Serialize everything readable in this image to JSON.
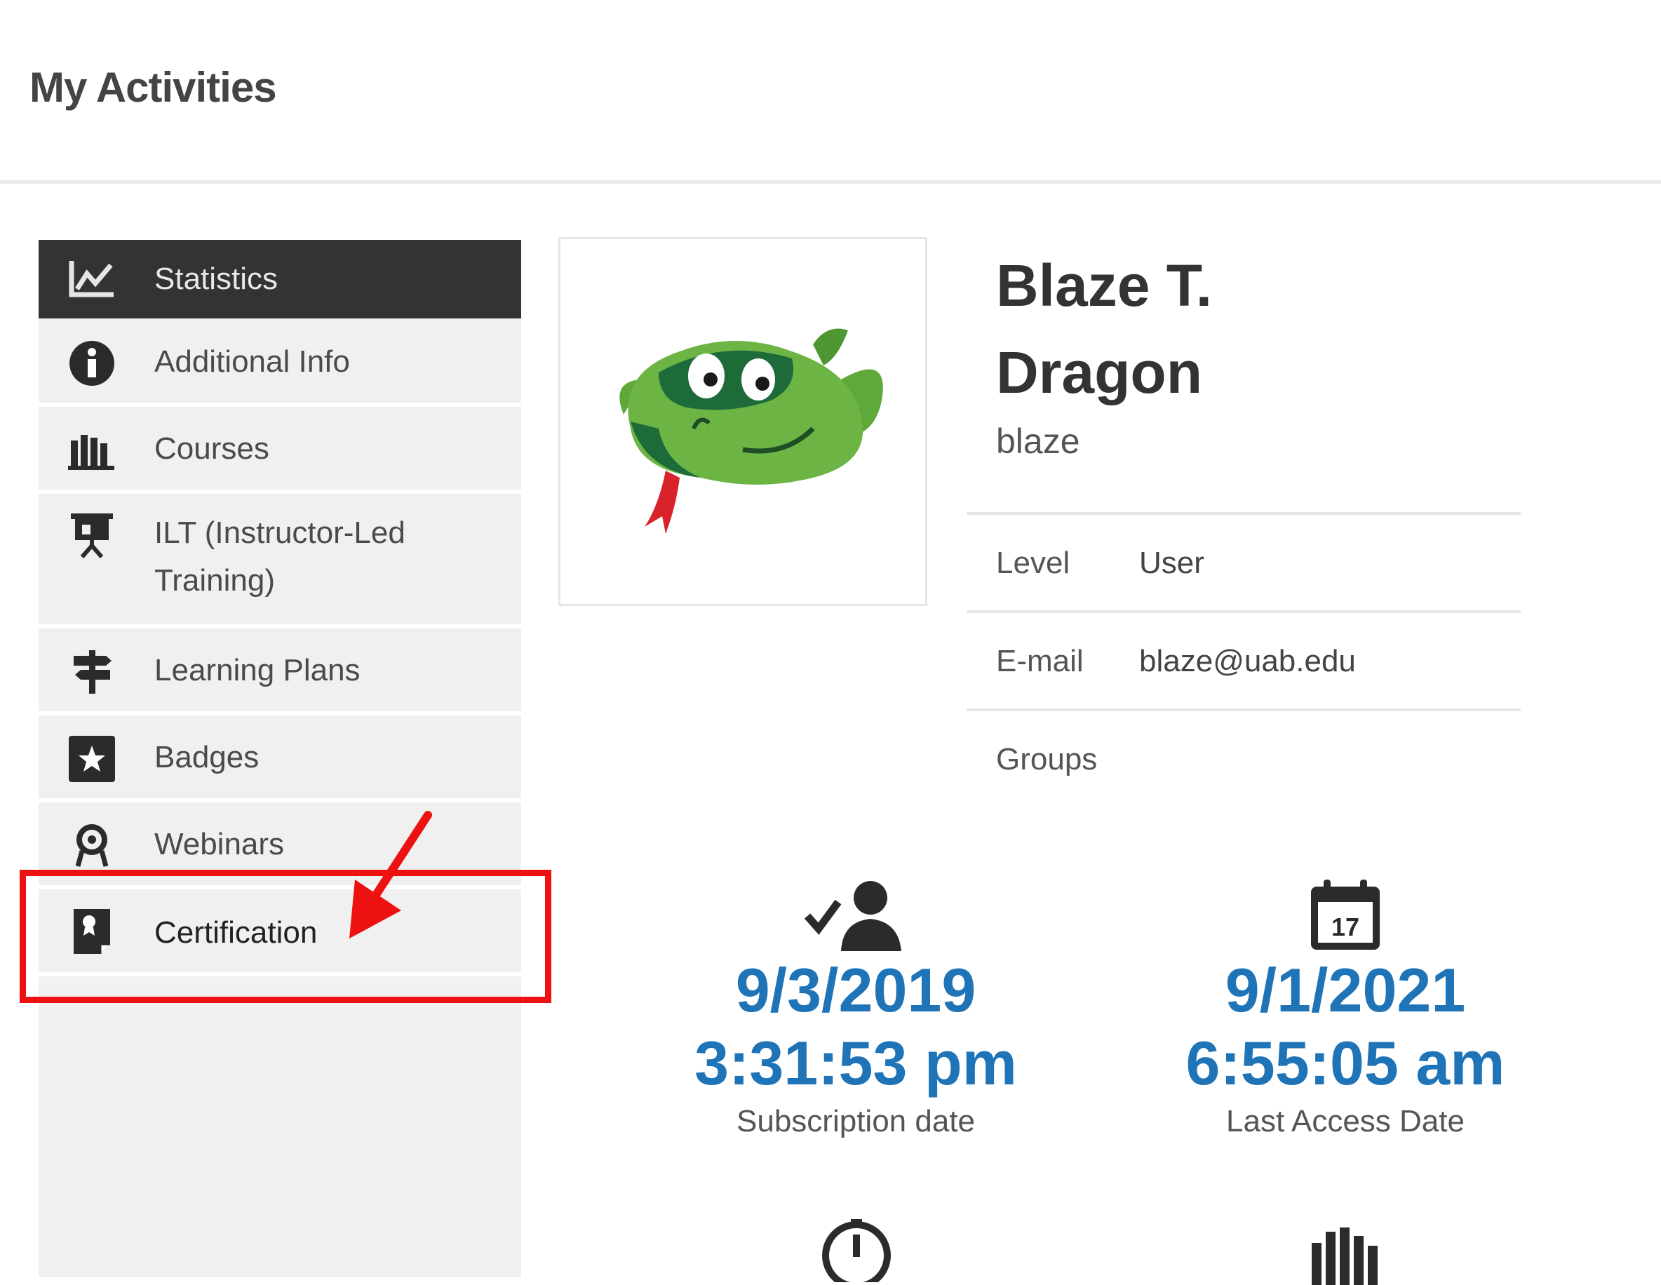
{
  "page": {
    "title": "My Activities"
  },
  "sidebar": {
    "items": [
      {
        "label": "Statistics",
        "icon": "chart-icon",
        "active": true
      },
      {
        "label": "Additional Info",
        "icon": "info-icon"
      },
      {
        "label": "Courses",
        "icon": "courses-icon"
      },
      {
        "label": "ILT (Instructor-Led\nTraining)",
        "icon": "presentation-icon"
      },
      {
        "label": "Learning Plans",
        "icon": "signpost-icon"
      },
      {
        "label": "Badges",
        "icon": "star-icon"
      },
      {
        "label": "Webinars",
        "icon": "webinar-icon"
      },
      {
        "label": "Certification",
        "icon": "certificate-icon",
        "highlighted": true
      }
    ]
  },
  "profile": {
    "name": "Blaze T. Dragon",
    "username": "blaze",
    "fields": [
      {
        "key": "Level",
        "value": "User"
      },
      {
        "key": "E-mail",
        "value": "blaze@uab.edu"
      },
      {
        "key": "Groups",
        "value": ""
      }
    ]
  },
  "stats": [
    {
      "date": "9/3/2019",
      "time": "3:31:53 pm",
      "caption": "Subscription date",
      "icon": "user-check-icon"
    },
    {
      "date": "9/1/2021",
      "time": "6:55:05 am",
      "caption": "Last Access Date",
      "icon": "calendar-icon",
      "icon_text": "17"
    }
  ],
  "colors": {
    "accent": "#1f74b8",
    "annotation": "#ee1111",
    "active_nav": "#333333"
  }
}
